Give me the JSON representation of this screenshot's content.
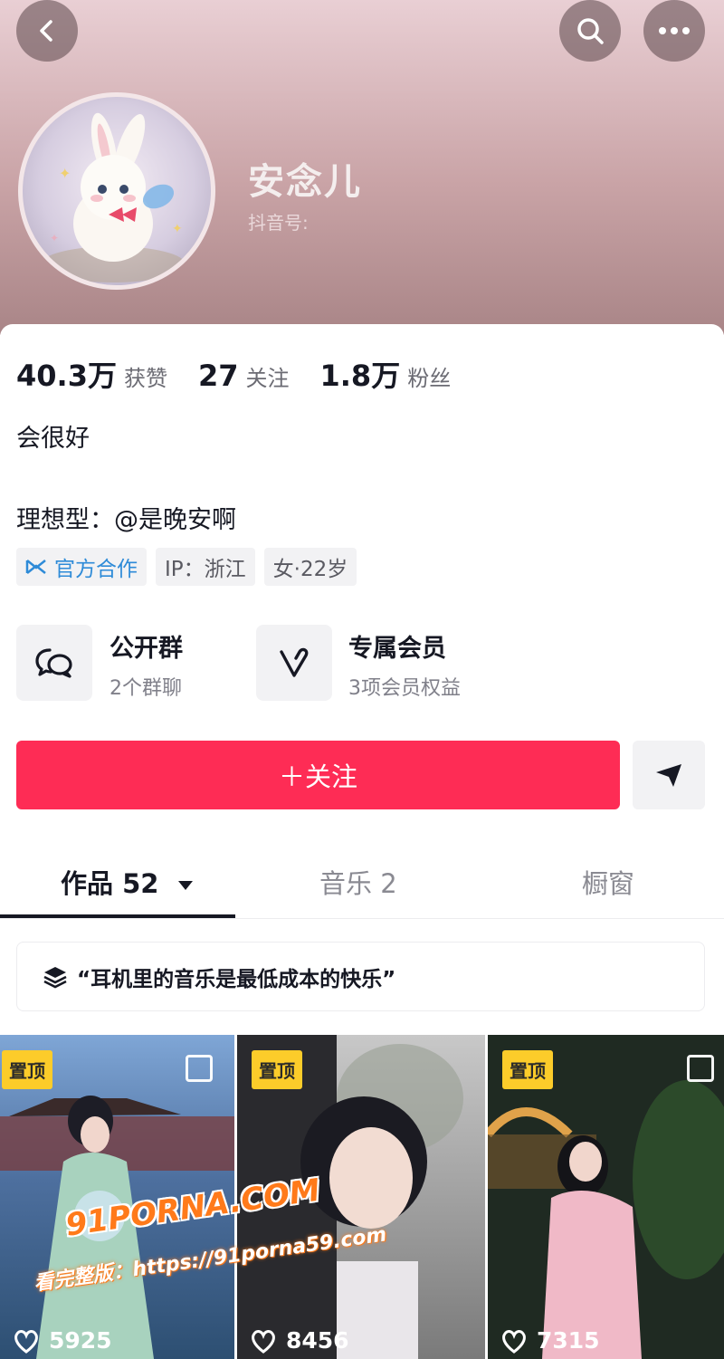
{
  "header": {
    "name": "安念儿",
    "douyin_id_label": "抖音号:"
  },
  "stats": [
    {
      "value": "40.3万",
      "label": "获赞"
    },
    {
      "value": "27",
      "label": "关注"
    },
    {
      "value": "1.8万",
      "label": "粉丝"
    }
  ],
  "bio": "会很好",
  "ideal": "理想型：@是晚安啊",
  "tags": {
    "official": "官方合作",
    "ip": "IP：浙江",
    "gender_age": "女·22岁"
  },
  "features": [
    {
      "title": "公开群",
      "sub": "2个群聊"
    },
    {
      "title": "专属会员",
      "sub": "3项会员权益"
    }
  ],
  "actions": {
    "follow": "＋关注"
  },
  "tabs": [
    {
      "label": "作品 52"
    },
    {
      "label": "音乐 2"
    },
    {
      "label": "橱窗"
    }
  ],
  "playlist": "“耳机里的音乐是最低成本的快乐”",
  "videos": [
    {
      "pin": "置顶",
      "likes": "5925"
    },
    {
      "pin": "置顶",
      "likes": "8456"
    },
    {
      "pin": "置顶",
      "likes": "7315"
    }
  ],
  "watermark": {
    "brand": "91PORNA.COM",
    "line": "看完整版：https://91porna59.com"
  },
  "colors": {
    "accent": "#fe2c55",
    "pin": "#fccc2a",
    "official": "#2e8bd8"
  }
}
